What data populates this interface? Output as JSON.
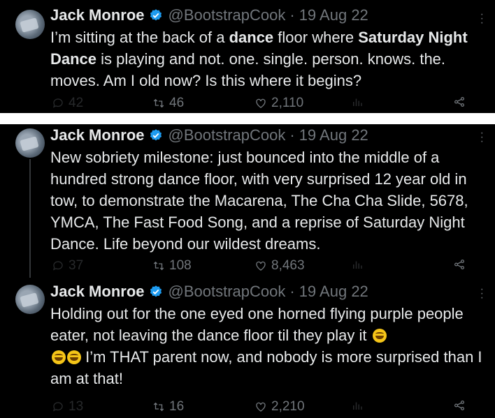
{
  "tweets": [
    {
      "name": "Jack Monroe",
      "handle": "@BootstrapCook",
      "separator": "·",
      "date": "19 Aug 22",
      "text_parts": [
        {
          "t": "I’m sitting at the back of a ",
          "b": false
        },
        {
          "t": "dance",
          "b": true
        },
        {
          "t": " floor where ",
          "b": false
        },
        {
          "t": "Saturday Night Dance",
          "b": true
        },
        {
          "t": " is playing and not. one. single. person. knows. the. moves. Am I old now? Is this where it begins?",
          "b": false
        }
      ],
      "replies": "42",
      "retweets": "46",
      "likes": "2,110"
    },
    {
      "name": "Jack Monroe",
      "handle": "@BootstrapCook",
      "separator": "·",
      "date": "19 Aug 22",
      "text": "New sobriety milestone: just bounced into the middle of a hundred strong dance floor, with very surprised 12 year old in tow, to demonstrate the Macarena, The Cha Cha Slide, 5678, YMCA, The Fast Food Song, and a reprise of Saturday Night Dance. Life beyond our wildest dreams.",
      "replies": "37",
      "retweets": "108",
      "likes": "8,463"
    },
    {
      "name": "Jack Monroe",
      "handle": "@BootstrapCook",
      "separator": "·",
      "date": "19 Aug 22",
      "text_a": "Holding out for the one eyed one horned flying purple people eater, not leaving the dance floor til they play it",
      "text_b": "I’m THAT parent now, and nobody is more surprised than I am at that!",
      "emoji_name": "rolling-on-floor-laughing",
      "replies": "13",
      "retweets": "16",
      "likes": "2,210"
    }
  ],
  "colors": {
    "background": "#000000",
    "text": "#e7e9ea",
    "muted": "#71767b",
    "verified": "#1d9bf0",
    "divider": "#ffffff"
  },
  "icons": [
    "verified-badge-icon",
    "reply-icon",
    "retweet-icon",
    "like-icon",
    "views-icon",
    "share-icon",
    "more-icon"
  ]
}
